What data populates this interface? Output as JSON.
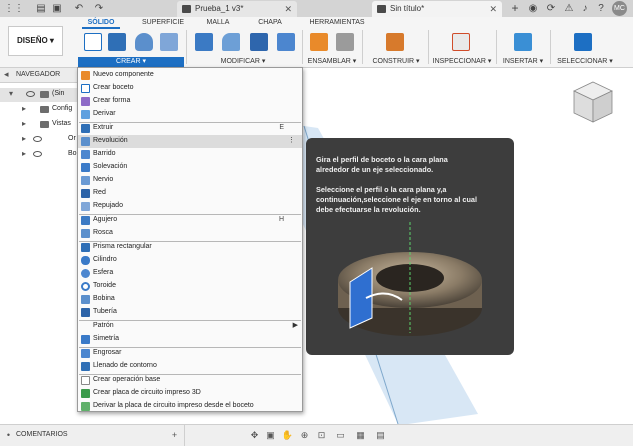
{
  "document_tabs": [
    {
      "title": "Prueba_1 v3*"
    },
    {
      "title": "Sin título*"
    }
  ],
  "user": {
    "initials": "MC"
  },
  "ribbon": {
    "design_label": "DISEÑO ▾",
    "tabs": [
      "SÓLIDO",
      "SUPERFICIE",
      "MALLA",
      "CHAPA",
      "HERRAMIENTAS"
    ],
    "active_tab": "SÓLIDO",
    "groups": [
      {
        "label": "CREAR ▾",
        "active": true
      },
      {
        "label": "MODIFICAR ▾"
      },
      {
        "label": "ENSAMBLAR ▾"
      },
      {
        "label": "CONSTRUIR ▾"
      },
      {
        "label": "INSPECCIONAR ▾"
      },
      {
        "label": "INSERTAR ▾"
      },
      {
        "label": "SELECCIONAR ▾"
      }
    ],
    "accent_color": "#1d6fc3"
  },
  "browser": {
    "title": "NAVEGADOR",
    "items": [
      {
        "label": "(Sin"
      },
      {
        "label": "Config"
      },
      {
        "label": "Vistas"
      },
      {
        "label": "Or"
      },
      {
        "label": "Bo"
      }
    ]
  },
  "menu": {
    "items": [
      {
        "label": "Nuevo componente",
        "icon": "new-component-icon"
      },
      {
        "label": "Crear boceto",
        "icon": "sketch-icon"
      },
      {
        "label": "Crear forma",
        "icon": "form-icon"
      },
      {
        "label": "Derivar",
        "icon": "derive-icon"
      },
      {
        "label": "Extruir",
        "shortcut": "E",
        "icon": "extrude-icon"
      },
      {
        "label": "Revolución",
        "icon": "revolve-icon",
        "hovered": true,
        "more": "⋮"
      },
      {
        "label": "Barrido",
        "icon": "sweep-icon"
      },
      {
        "label": "Solevación",
        "icon": "loft-icon"
      },
      {
        "label": "Nervio",
        "icon": "rib-icon"
      },
      {
        "label": "Red",
        "icon": "web-icon"
      },
      {
        "label": "Repujado",
        "icon": "emboss-icon"
      },
      {
        "label": "Agujero",
        "shortcut": "H",
        "icon": "hole-icon"
      },
      {
        "label": "Rosca",
        "icon": "thread-icon"
      },
      {
        "label": "Prisma rectangular",
        "icon": "box-icon"
      },
      {
        "label": "Cilindro",
        "icon": "cylinder-icon"
      },
      {
        "label": "Esfera",
        "icon": "sphere-icon"
      },
      {
        "label": "Toroide",
        "icon": "torus-icon"
      },
      {
        "label": "Bobina",
        "icon": "coil-icon"
      },
      {
        "label": "Tubería",
        "icon": "pipe-icon"
      },
      {
        "label": "Patrón",
        "submenu": "▶"
      },
      {
        "label": "Simetría",
        "icon": "mirror-icon"
      },
      {
        "label": "Engrosar",
        "icon": "thicken-icon"
      },
      {
        "label": "Llenado de contorno",
        "icon": "boundary-fill-icon"
      },
      {
        "label": "Crear operación base",
        "icon": "base-feature-icon"
      },
      {
        "label": "Crear placa de circuito impreso 3D",
        "icon": "pcb-icon"
      },
      {
        "label": "Derivar la placa de circuito impreso desde el boceto",
        "icon": "pcb-derive-icon"
      }
    ]
  },
  "tooltip": {
    "line1": "Gira el perfil de boceto o la cara plana",
    "line2": "alrededor de un eje seleccionado.",
    "line3": "Seleccione el perfil o la cara plana y,a",
    "line4": "continuación,seleccione el eje en torno al cual",
    "line5": "debe efectuarse la revolución."
  },
  "bottom": {
    "comments_label": "COMENTARIOS"
  }
}
